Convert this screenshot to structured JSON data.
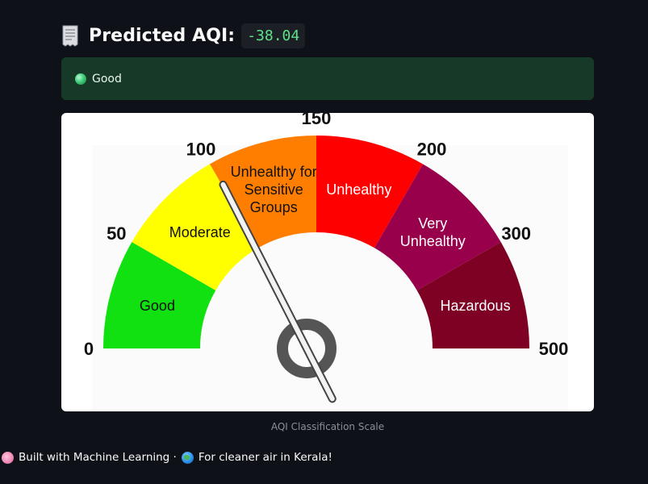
{
  "header": {
    "icon": "receipt-document-icon",
    "title": "Predicted AQI:",
    "value": "-38.04",
    "value_color": "#5ce488"
  },
  "alert": {
    "icon": "green-circle-icon",
    "text": "Good",
    "background": "#173928"
  },
  "gauge": {
    "needle_value": 105,
    "scale_labels": [
      "0",
      "50",
      "100",
      "150",
      "200",
      "300",
      "500"
    ],
    "segments": [
      {
        "lines": [
          "Good"
        ],
        "color": "#11e011"
      },
      {
        "lines": [
          "Moderate"
        ],
        "color": "#ffff00"
      },
      {
        "lines": [
          "Unhealthy for",
          "Sensitive",
          "Groups"
        ],
        "color": "#ff7e00"
      },
      {
        "lines": [
          "Unhealthy"
        ],
        "color": "#ff0000"
      },
      {
        "lines": [
          "Very",
          "Unhealthy"
        ],
        "color": "#99004c"
      },
      {
        "lines": [
          "Hazardous"
        ],
        "color": "#7e0023"
      }
    ]
  },
  "caption": "AQI Classification Scale",
  "footer": {
    "part1": "Built with Machine Learning ·",
    "part2": "For cleaner air in Kerala!"
  }
}
